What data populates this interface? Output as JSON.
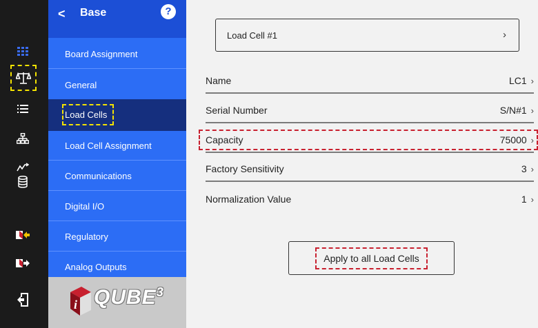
{
  "rail": {
    "icons": [
      "grid-icon",
      "scale-icon",
      "list-icon",
      "network-icon",
      "signal-icon",
      "database-icon",
      "import-icon",
      "export-icon",
      "logout-icon"
    ]
  },
  "menu": {
    "back": "<",
    "title": "Base",
    "help": "?",
    "items": [
      {
        "label": "Board Assignment"
      },
      {
        "label": "General"
      },
      {
        "label": "Load Cells"
      },
      {
        "label": "Load Cell Assignment"
      },
      {
        "label": "Communications"
      },
      {
        "label": "Digital I/O"
      },
      {
        "label": "Regulatory"
      },
      {
        "label": "Analog Outputs"
      }
    ],
    "logo": "QUBE",
    "logo_sup": "3"
  },
  "content": {
    "selector_label": "Load Cell #1",
    "properties": [
      {
        "name": "Name",
        "value": "LC1"
      },
      {
        "name": "Serial Number",
        "value": "S/N#1"
      },
      {
        "name": "Capacity",
        "value": "75000"
      },
      {
        "name": "Factory Sensitivity",
        "value": "3"
      },
      {
        "name": "Normalization Value",
        "value": "1"
      }
    ],
    "apply_label": "Apply to all Load Cells"
  },
  "colors": {
    "rail_bg": "#1b1b1b",
    "menu_bg": "#2c6df5",
    "menu_active": "#152f7e",
    "highlight_yellow": "#f5e400",
    "highlight_red": "#c8202f"
  }
}
